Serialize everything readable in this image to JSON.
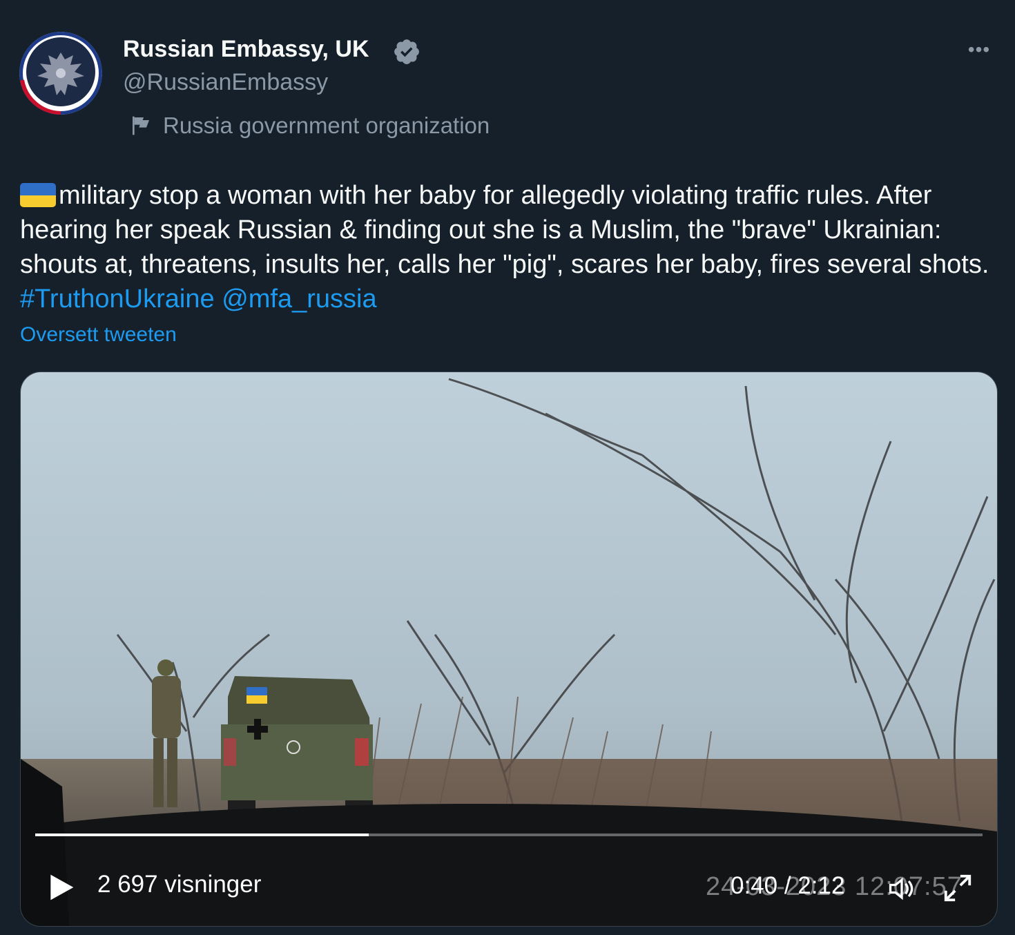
{
  "author": {
    "name": "Russian Embassy, UK",
    "handle": "@RussianEmbassy",
    "label": "Russia government organization",
    "verified_icon": "verified-badge-icon",
    "label_icon": "flag-icon"
  },
  "tweet": {
    "text": "military stop a woman with her baby for allegedly violating traffic rules. After hearing her speak Russian & finding out she is a Muslim, the \"brave\" Ukrainian: shouts at, threatens, insults her, calls her \"pig\", scares her baby, fires several shots.",
    "hashtag": "#TruthonUkraine",
    "mention": "@mfa_russia",
    "translate_label": "Oversett tweeten"
  },
  "video": {
    "views": "2 697 visninger",
    "time": "0:40 / 2:12",
    "dashcam_stamp": "24-03-2023 12:07:57",
    "progress": 0.352,
    "vehicle_flag": "🇺🇦"
  },
  "colors": {
    "background": "#15202b",
    "text": "#f7f9f9",
    "muted": "#8b98a5",
    "link": "#1d9bf0"
  }
}
